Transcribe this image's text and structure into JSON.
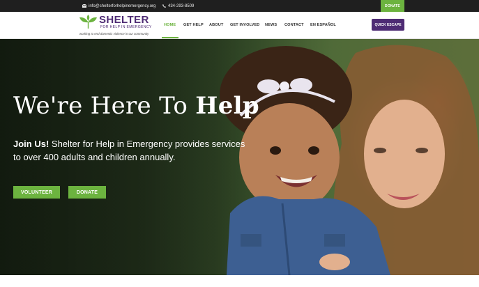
{
  "topbar": {
    "email": "info@shelterforhelpinemergency.org",
    "phone": "434-293-8509",
    "donate_label": "DONATE",
    "icons": [
      "envelope-icon",
      "phone-icon"
    ]
  },
  "logo": {
    "brand": "SHELTER",
    "sub": "FOR HELP IN EMERGENCY",
    "tagline": "working to end domestic violence in our community"
  },
  "nav": {
    "items": [
      {
        "label": "HOME",
        "active": true
      },
      {
        "label": "GET HELP",
        "active": false
      },
      {
        "label": "ABOUT",
        "active": false
      },
      {
        "label": "GET INVOLVED",
        "active": false
      },
      {
        "label": "NEWS",
        "active": false
      },
      {
        "label": "CONTACT",
        "active": false
      },
      {
        "label": "EN ESPAÑOL",
        "active": false
      }
    ],
    "quick_escape_label": "QUICK ESCAPE"
  },
  "hero": {
    "title_light": "We're Here To ",
    "title_bold": "Help",
    "text_bold": "Join Us!",
    "text_rest": " Shelter for Help in Emergency provides services to over 400 adults and children annually.",
    "buttons": {
      "volunteer": "VOLUNTEER",
      "donate": "DONATE"
    }
  },
  "colors": {
    "accent_green": "#6cb33f",
    "brand_purple": "#4e2b74",
    "topbar_bg": "#1f1f1f"
  }
}
